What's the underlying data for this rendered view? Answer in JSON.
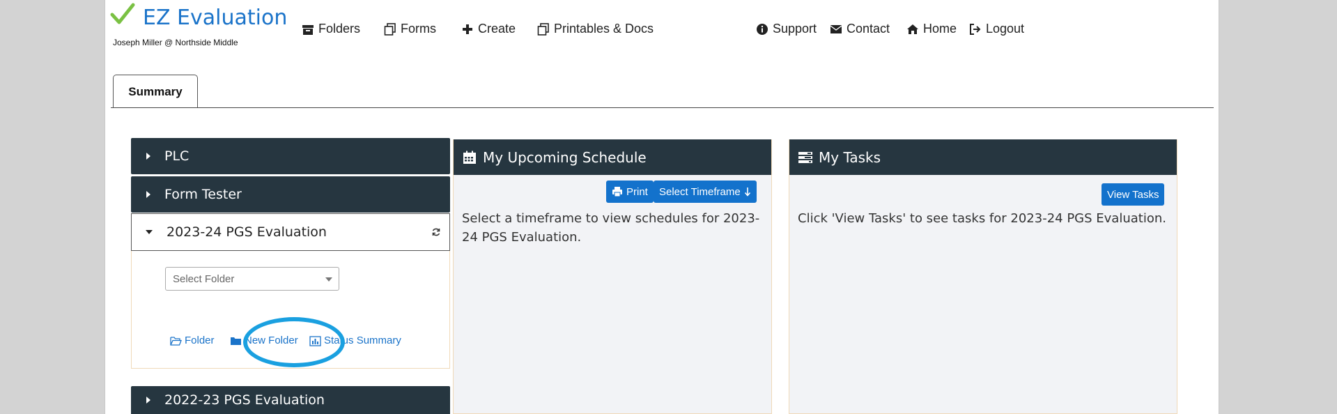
{
  "app": {
    "title": "EZ Evaluation",
    "user": "Joseph Miller @ Northside Middle",
    "accent": "#1a73c9",
    "check_color": "#7ac143"
  },
  "nav": {
    "left": [
      {
        "label": "Folders",
        "icon": "archive-box-icon"
      },
      {
        "label": "Forms",
        "icon": "copy-icon"
      },
      {
        "label": "Create",
        "icon": "plus-icon"
      },
      {
        "label": "Printables & Docs",
        "icon": "copy-icon"
      }
    ],
    "right": [
      {
        "label": "Support",
        "icon": "info-circle-icon"
      },
      {
        "label": "Contact",
        "icon": "envelope-icon"
      },
      {
        "label": "Home",
        "icon": "home-icon"
      },
      {
        "label": "Logout",
        "icon": "logout-icon"
      }
    ]
  },
  "tabs": [
    {
      "label": "Summary",
      "active": true
    }
  ],
  "sidebar": {
    "groups": [
      {
        "label": "PLC",
        "expanded": false
      },
      {
        "label": "Form Tester",
        "expanded": false
      },
      {
        "label": "2023-24 PGS Evaluation",
        "expanded": true
      },
      {
        "label": "2022-23 PGS Evaluation",
        "expanded": false
      }
    ],
    "select_placeholder": "Select Folder",
    "links": {
      "folder": "Folder",
      "new_folder": "New Folder",
      "status_summary": "Status Summary"
    }
  },
  "schedule": {
    "title": "My Upcoming Schedule",
    "print_label": "Print",
    "timeframe_label": "Select Timeframe",
    "message": "Select a timeframe to view schedules for 2023-24 PGS Evaluation."
  },
  "tasks": {
    "title": "My Tasks",
    "view_label": "View Tasks",
    "message": "Click 'View Tasks' to see tasks for 2023-24 PGS Evaluation."
  }
}
